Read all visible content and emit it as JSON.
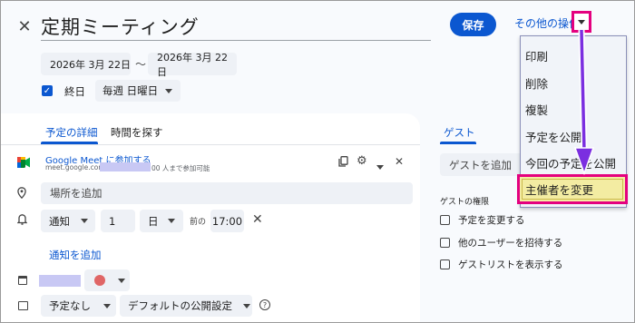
{
  "header": {
    "title": "定期ミーティング",
    "save_label": "保存",
    "more_actions_label": "その他の操作"
  },
  "dates": {
    "start": "2026年 3月 22日",
    "separator": "〜",
    "end": "2026年 3月 22日"
  },
  "all_day": {
    "label": "終日",
    "checked": true
  },
  "repeat": {
    "value": "毎週 日曜日"
  },
  "tabs": [
    {
      "label": "予定の詳細",
      "active": true
    },
    {
      "label": "時間を探す",
      "active": false
    }
  ],
  "meet": {
    "title": "Google Meet に参加する",
    "url": "meet.google.com/",
    "limit": "00 人まで参加可能"
  },
  "location": {
    "placeholder": "場所を追加"
  },
  "notification": {
    "type": "通知",
    "amount": "1",
    "unit": "日",
    "before": "前の",
    "time": "17:00"
  },
  "add_notification_label": "通知を追加",
  "busy": {
    "value": "予定なし"
  },
  "visibility": {
    "value": "デフォルトの公開設定"
  },
  "guests": {
    "tab_label": "ゲスト",
    "input_placeholder": "ゲストを追加",
    "permissions_title": "ゲストの権限",
    "permissions": [
      {
        "label": "予定を変更する",
        "checked": false
      },
      {
        "label": "他のユーザーを招待する",
        "checked": false
      },
      {
        "label": "ゲストリストを表示する",
        "checked": false
      }
    ]
  },
  "menu": {
    "items": [
      {
        "label": "印刷"
      },
      {
        "label": "削除"
      },
      {
        "label": "複製"
      },
      {
        "label": "予定を公開"
      },
      {
        "label": "今回の予定を公開"
      }
    ],
    "highlighted_item": "主催者を変更"
  },
  "colors": {
    "accent": "#0b57d0",
    "annotation": "#e4007f",
    "highlight": "#f3eca2",
    "arrow": "#7b2fe0"
  }
}
